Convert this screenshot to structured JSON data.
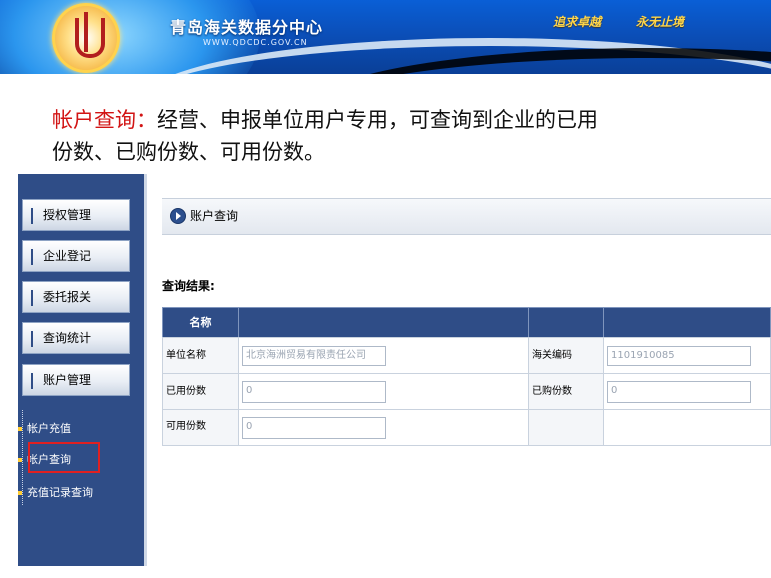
{
  "header": {
    "title": "青岛海关数据分中心",
    "url": "WWW.QDCDC.GOV.CN",
    "slogan_left": "追求卓越",
    "slogan_right": "永无止境"
  },
  "description": {
    "highlight": "帐户查询：",
    "line1": "经营、申报单位用户专用，可查询到企业的已用",
    "line2": "份数、已购份数、可用份数。"
  },
  "sidebar": {
    "items": [
      {
        "label": "授权管理"
      },
      {
        "label": "企业登记"
      },
      {
        "label": "委托报关"
      },
      {
        "label": "查询统计"
      },
      {
        "label": "账户管理"
      }
    ],
    "subitems": [
      {
        "label": "帐户充值"
      },
      {
        "label": "帐户查询"
      },
      {
        "label": "充值记录查询"
      }
    ]
  },
  "page": {
    "title": "账户查询",
    "result_label": "查询结果:"
  },
  "table": {
    "header_name": "名称",
    "rows": [
      {
        "label1": "单位名称",
        "value1": "北京海洲贸易有限责任公司",
        "label2": "海关编码",
        "value2": "1101910085"
      },
      {
        "label1": "已用份数",
        "value1": "0",
        "label2": "已购份数",
        "value2": "0"
      },
      {
        "label1": "可用份数",
        "value1": "0"
      }
    ]
  },
  "colors": {
    "banner_blue": "#0b4fb9",
    "sidebar_blue": "#2f4d87",
    "highlight_red": "#d21414",
    "slogan_yellow": "#ffd64a"
  }
}
